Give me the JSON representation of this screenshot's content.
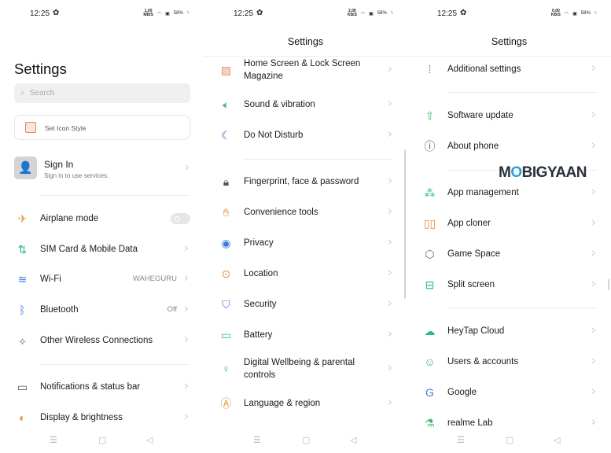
{
  "status_bars": [
    {
      "time": "12:25",
      "speed": "1.00",
      "speed_unit": "MB/S",
      "battery": "58%"
    },
    {
      "time": "12:25",
      "speed": "2.00",
      "speed_unit": "KB/S",
      "battery": "58%"
    },
    {
      "time": "12:25",
      "speed": "0.00",
      "speed_unit": "KB/S",
      "battery": "58%"
    }
  ],
  "panel1": {
    "title": "Settings",
    "search_placeholder": "Search",
    "icon_style": "Set Icon Style",
    "sign_in": {
      "title": "Sign In",
      "subtitle": "Sign in to use services."
    },
    "items": [
      {
        "label": "Airplane mode",
        "icon": "airplane-icon",
        "toggle": false
      },
      {
        "label": "SIM Card & Mobile Data",
        "icon": "sim-data-icon"
      },
      {
        "label": "Wi-Fi",
        "icon": "wifi-icon",
        "value": "WAHEGURU"
      },
      {
        "label": "Bluetooth",
        "icon": "bluetooth-icon",
        "value": "Off"
      },
      {
        "label": "Other Wireless Connections",
        "icon": "wireless-connections-icon"
      },
      {
        "label": "Notifications & status bar",
        "icon": "notifications-icon"
      },
      {
        "label": "Display & brightness",
        "icon": "display-brightness-icon"
      }
    ]
  },
  "panel2": {
    "title": "Settings",
    "items": [
      {
        "label": "Home Screen & Lock Screen Magazine",
        "icon": "home-screen-icon"
      },
      {
        "label": "Sound & vibration",
        "icon": "sound-icon"
      },
      {
        "label": "Do Not Disturb",
        "icon": "moon-icon"
      },
      {
        "label": "Fingerprint, face & password",
        "icon": "lock-icon"
      },
      {
        "label": "Convenience tools",
        "icon": "convenience-tools-icon"
      },
      {
        "label": "Privacy",
        "icon": "privacy-icon"
      },
      {
        "label": "Location",
        "icon": "location-icon"
      },
      {
        "label": "Security",
        "icon": "security-shield-icon"
      },
      {
        "label": "Battery",
        "icon": "battery-icon"
      },
      {
        "label": "Digital Wellbeing & parental controls",
        "icon": "wellbeing-icon"
      },
      {
        "label": "Language & region",
        "icon": "language-icon"
      }
    ]
  },
  "panel3": {
    "title": "Settings",
    "items": [
      {
        "label": "Additional settings",
        "icon": "additional-settings-icon"
      },
      {
        "label": "Software update",
        "icon": "software-update-icon"
      },
      {
        "label": "About phone",
        "icon": "info-icon"
      },
      {
        "label": "App management",
        "icon": "app-management-icon"
      },
      {
        "label": "App cloner",
        "icon": "app-cloner-icon"
      },
      {
        "label": "Game Space",
        "icon": "game-space-icon"
      },
      {
        "label": "Split screen",
        "icon": "split-screen-icon"
      },
      {
        "label": "HeyTap Cloud",
        "icon": "cloud-icon"
      },
      {
        "label": "Users & accounts",
        "icon": "user-accounts-icon"
      },
      {
        "label": "Google",
        "icon": "google-icon"
      },
      {
        "label": "realme Lab",
        "icon": "lab-flask-icon"
      }
    ]
  },
  "watermark": "MOBIGYAAN",
  "colors": {
    "accent_green": "#3cb89a",
    "orange": "#e8903c",
    "blue": "#3b7ad8",
    "text": "#1a1a1a",
    "chevron": "#c4c4c4"
  }
}
